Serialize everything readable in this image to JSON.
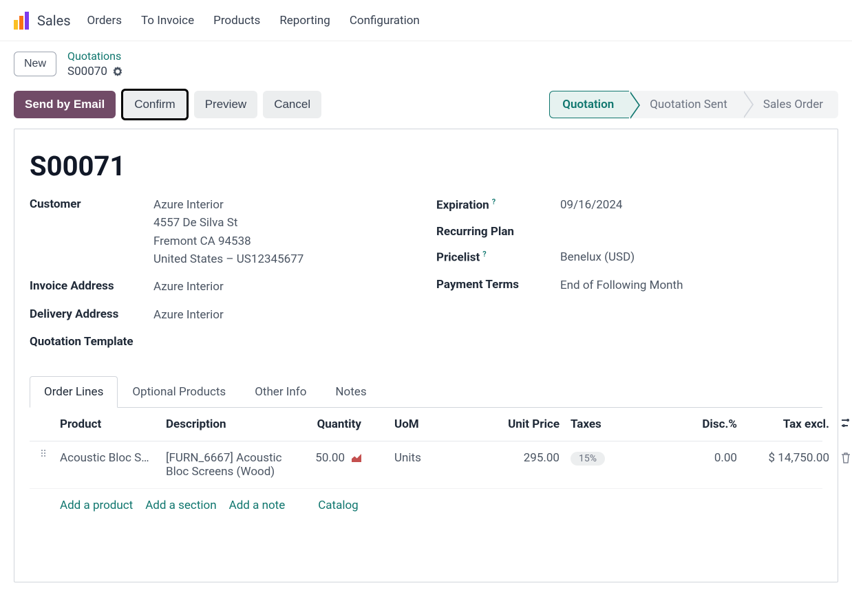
{
  "app": {
    "name": "Sales"
  },
  "nav": [
    "Orders",
    "To Invoice",
    "Products",
    "Reporting",
    "Configuration"
  ],
  "breadcrumb": {
    "new_label": "New",
    "parent": "Quotations",
    "current": "S00070"
  },
  "actions": {
    "send_email": "Send by Email",
    "confirm": "Confirm",
    "preview": "Preview",
    "cancel": "Cancel"
  },
  "status": {
    "stages": [
      "Quotation",
      "Quotation Sent",
      "Sales Order"
    ],
    "active_index": 0
  },
  "record": {
    "title": "S00071",
    "customer_label": "Customer",
    "customer": {
      "name": "Azure Interior",
      "street": "4557 De Silva St",
      "city_line": "Fremont CA 94538",
      "country_line": "United States – US12345677"
    },
    "invoice_address_label": "Invoice Address",
    "invoice_address": "Azure Interior",
    "delivery_address_label": "Delivery Address",
    "delivery_address": "Azure Interior",
    "quotation_template_label": "Quotation Template",
    "expiration_label": "Expiration",
    "expiration": "09/16/2024",
    "recurring_plan_label": "Recurring Plan",
    "pricelist_label": "Pricelist",
    "pricelist": "Benelux (USD)",
    "payment_terms_label": "Payment Terms",
    "payment_terms": "End of Following Month"
  },
  "tabs": [
    "Order Lines",
    "Optional Products",
    "Other Info",
    "Notes"
  ],
  "order_lines": {
    "columns": {
      "product": "Product",
      "description": "Description",
      "quantity": "Quantity",
      "uom": "UoM",
      "unit_price": "Unit Price",
      "taxes": "Taxes",
      "disc": "Disc.%",
      "tax_excl": "Tax excl."
    },
    "rows": [
      {
        "product": "Acoustic Bloc S…",
        "description": "[FURN_6667] Acoustic Bloc Screens (Wood)",
        "quantity": "50.00",
        "uom": "Units",
        "unit_price": "295.00",
        "taxes": "15%",
        "disc": "0.00",
        "tax_excl": "$ 14,750.00"
      }
    ],
    "action_links": {
      "add_product": "Add a product",
      "add_section": "Add a section",
      "add_note": "Add a note",
      "catalog": "Catalog"
    }
  }
}
